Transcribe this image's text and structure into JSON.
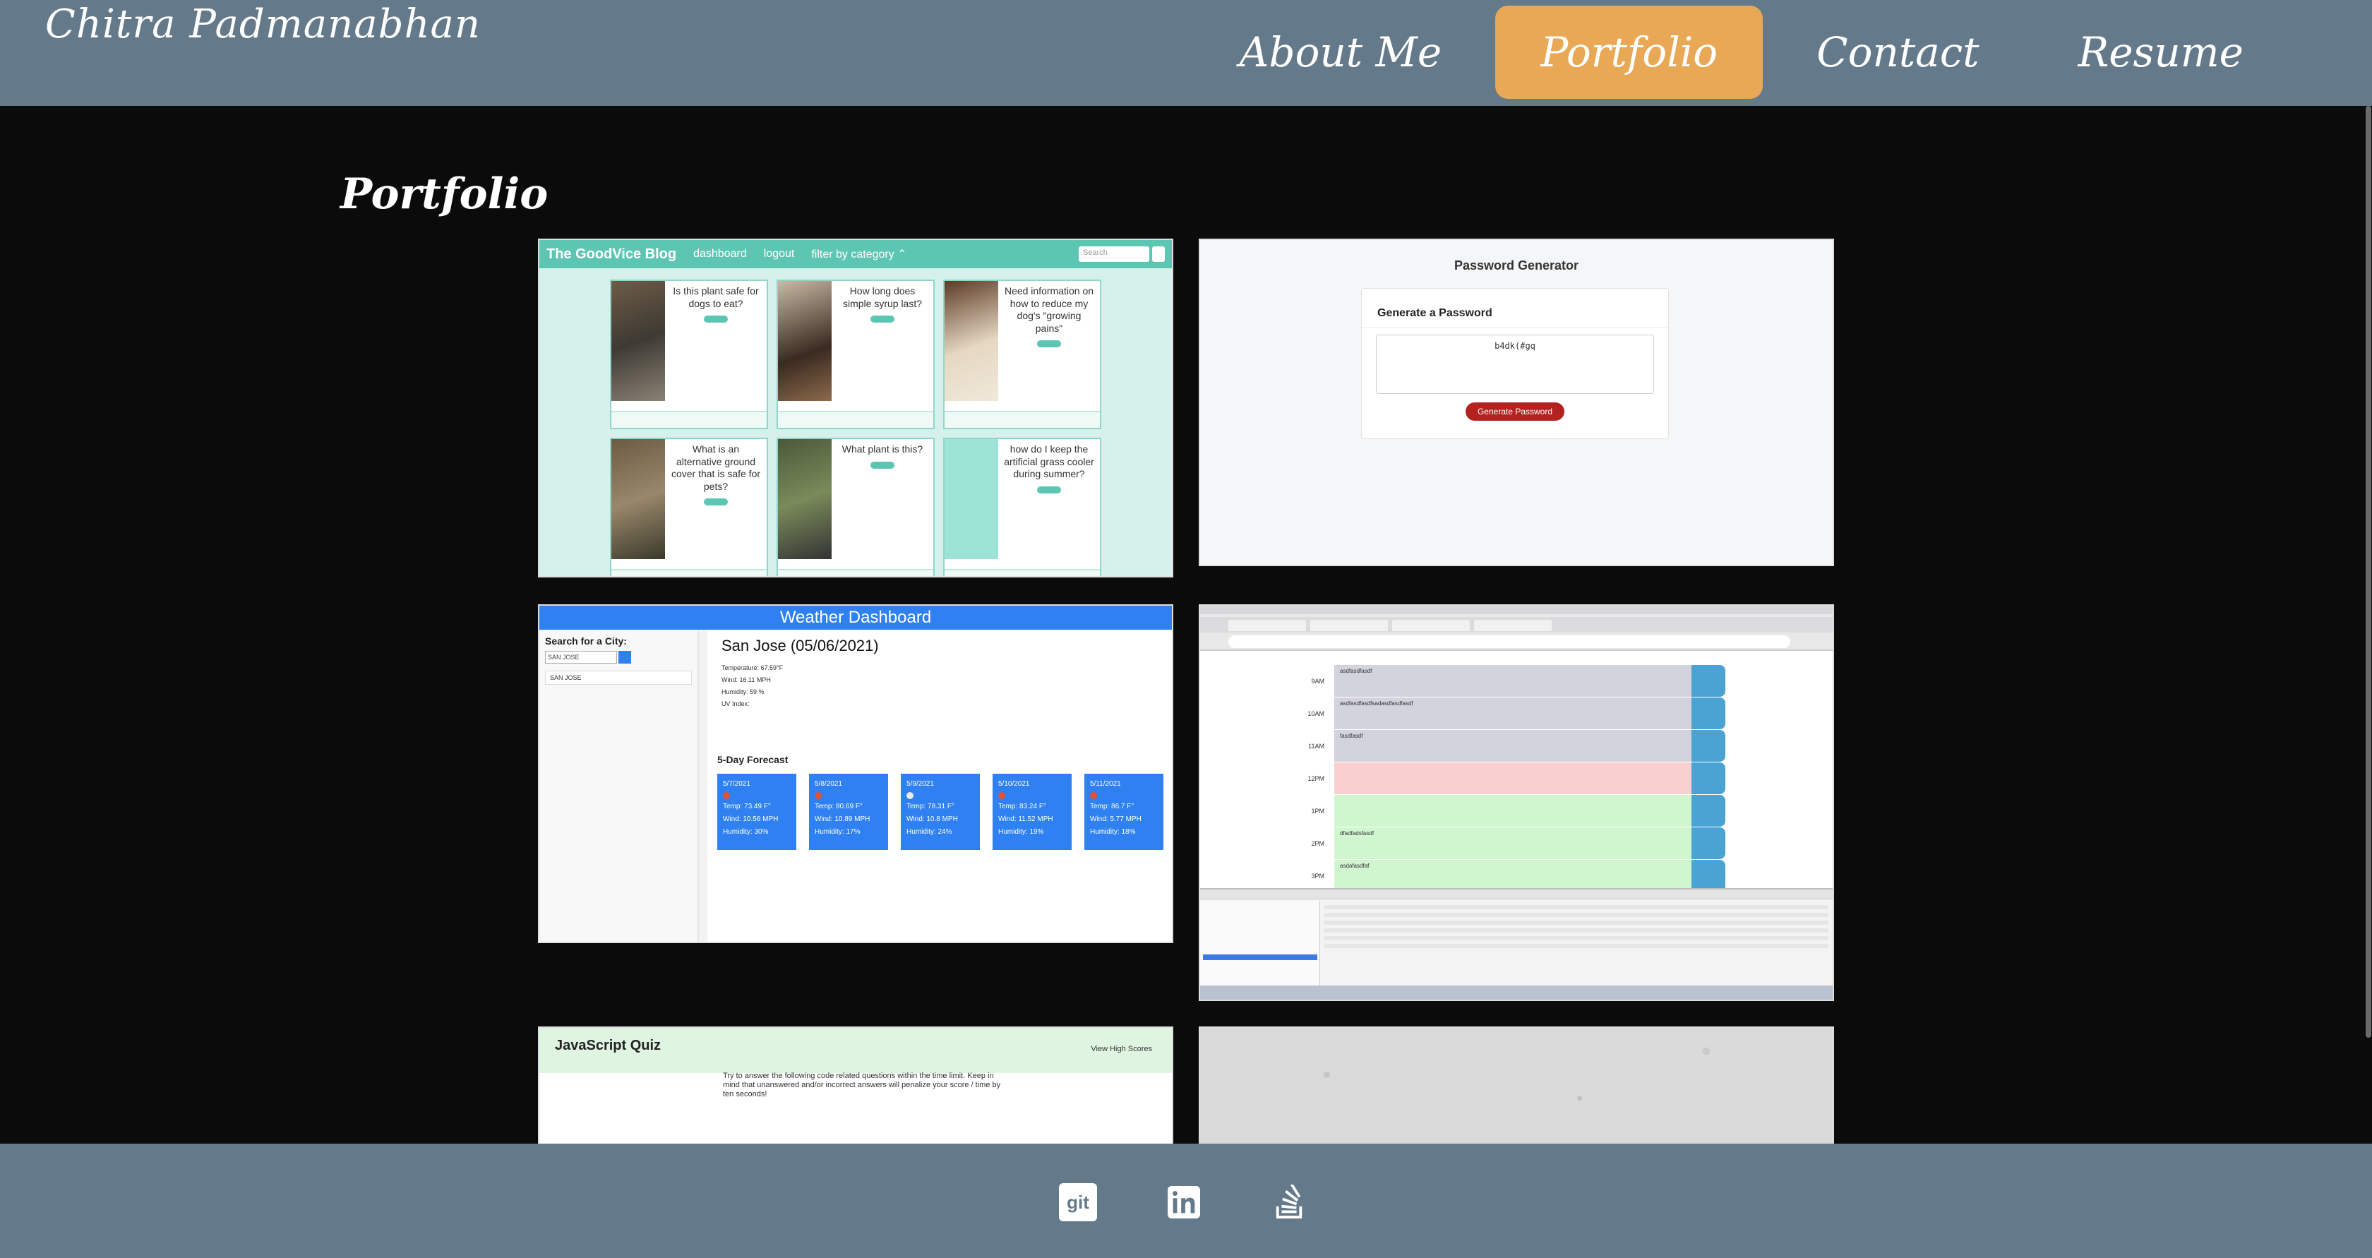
{
  "site": {
    "name": "Chitra Padmanabhan"
  },
  "nav": {
    "items": [
      {
        "label": "About Me",
        "active": false
      },
      {
        "label": "Portfolio",
        "active": true
      },
      {
        "label": "Contact",
        "active": false
      },
      {
        "label": "Resume",
        "active": false
      }
    ]
  },
  "colors": {
    "header": "#64798a",
    "active_nav": "#e8a855",
    "background": "#0b0b0b"
  },
  "portfolio": {
    "title": "Portfolio",
    "blog": {
      "brand": "The GoodVice Blog",
      "nav": [
        "dashboard",
        "logout",
        "filter by category ⌃"
      ],
      "search_placeholder": "Search",
      "posts": [
        "Is this plant safe for dogs to eat?",
        "How long does simple syrup last?",
        "Need information on how to reduce my dog's \"growing pains\"",
        "What is an alternative ground cover that is safe for pets?",
        "What plant is this?",
        "how do I keep the artificial grass cooler during summer?"
      ]
    },
    "password": {
      "title": "Password Generator",
      "card_title": "Generate a Password",
      "output": "b4dk(#gq",
      "button": "Generate Password"
    },
    "weather": {
      "title": "Weather Dashboard",
      "search_label": "Search for a City:",
      "search_value": "SAN JOSE",
      "history": [
        "SAN JOSE"
      ],
      "current_city": "San Jose (05/06/2021)",
      "stats": [
        "Temperature: 67.59°F",
        "Wind: 16.11 MPH",
        "Humidity: 59 %",
        "UV Index:"
      ],
      "forecast_title": "5-Day Forecast",
      "forecast": [
        {
          "date": "5/7/2021",
          "temp": "Temp: 73.49 F°",
          "wind": "Wind: 10.56 MPH",
          "humidity": "Humidity: 30%"
        },
        {
          "date": "5/8/2021",
          "temp": "Temp: 80.69 F°",
          "wind": "Wind: 10.89 MPH",
          "humidity": "Humidity: 17%"
        },
        {
          "date": "5/9/2021",
          "temp": "Temp: 78.31 F°",
          "wind": "Wind: 10.8 MPH",
          "humidity": "Humidity: 24%"
        },
        {
          "date": "5/10/2021",
          "temp": "Temp: 83.24 F°",
          "wind": "Wind: 11.52 MPH",
          "humidity": "Humidity: 19%"
        },
        {
          "date": "5/11/2021",
          "temp": "Temp: 86.7 F°",
          "wind": "Wind: 5.77 MPH",
          "humidity": "Humidity: 18%"
        }
      ]
    },
    "scheduler": {
      "rows": [
        {
          "hour": "9AM",
          "text": "asdfasdfasdf",
          "state": "past"
        },
        {
          "hour": "10AM",
          "text": "asdfasdfasdfsadasdfasdfasdf",
          "state": "past"
        },
        {
          "hour": "11AM",
          "text": "fasdfasdf",
          "state": "past"
        },
        {
          "hour": "12PM",
          "text": "",
          "state": "present"
        },
        {
          "hour": "1PM",
          "text": "",
          "state": "future"
        },
        {
          "hour": "2PM",
          "text": "dfadfadsfasdf",
          "state": "future"
        },
        {
          "hour": "3PM",
          "text": "asdafasdfaf",
          "state": "future"
        }
      ]
    },
    "quiz": {
      "title": "JavaScript Quiz",
      "link": "View High Scores",
      "text": "Try to answer the following code related questions within the time limit. Keep in mind that unanswered and/or incorrect answers will penalize your score / time by ten seconds!"
    }
  },
  "footer": {
    "icons": [
      "git-icon",
      "linkedin-icon",
      "stackoverflow-icon"
    ],
    "git_label": "git"
  }
}
